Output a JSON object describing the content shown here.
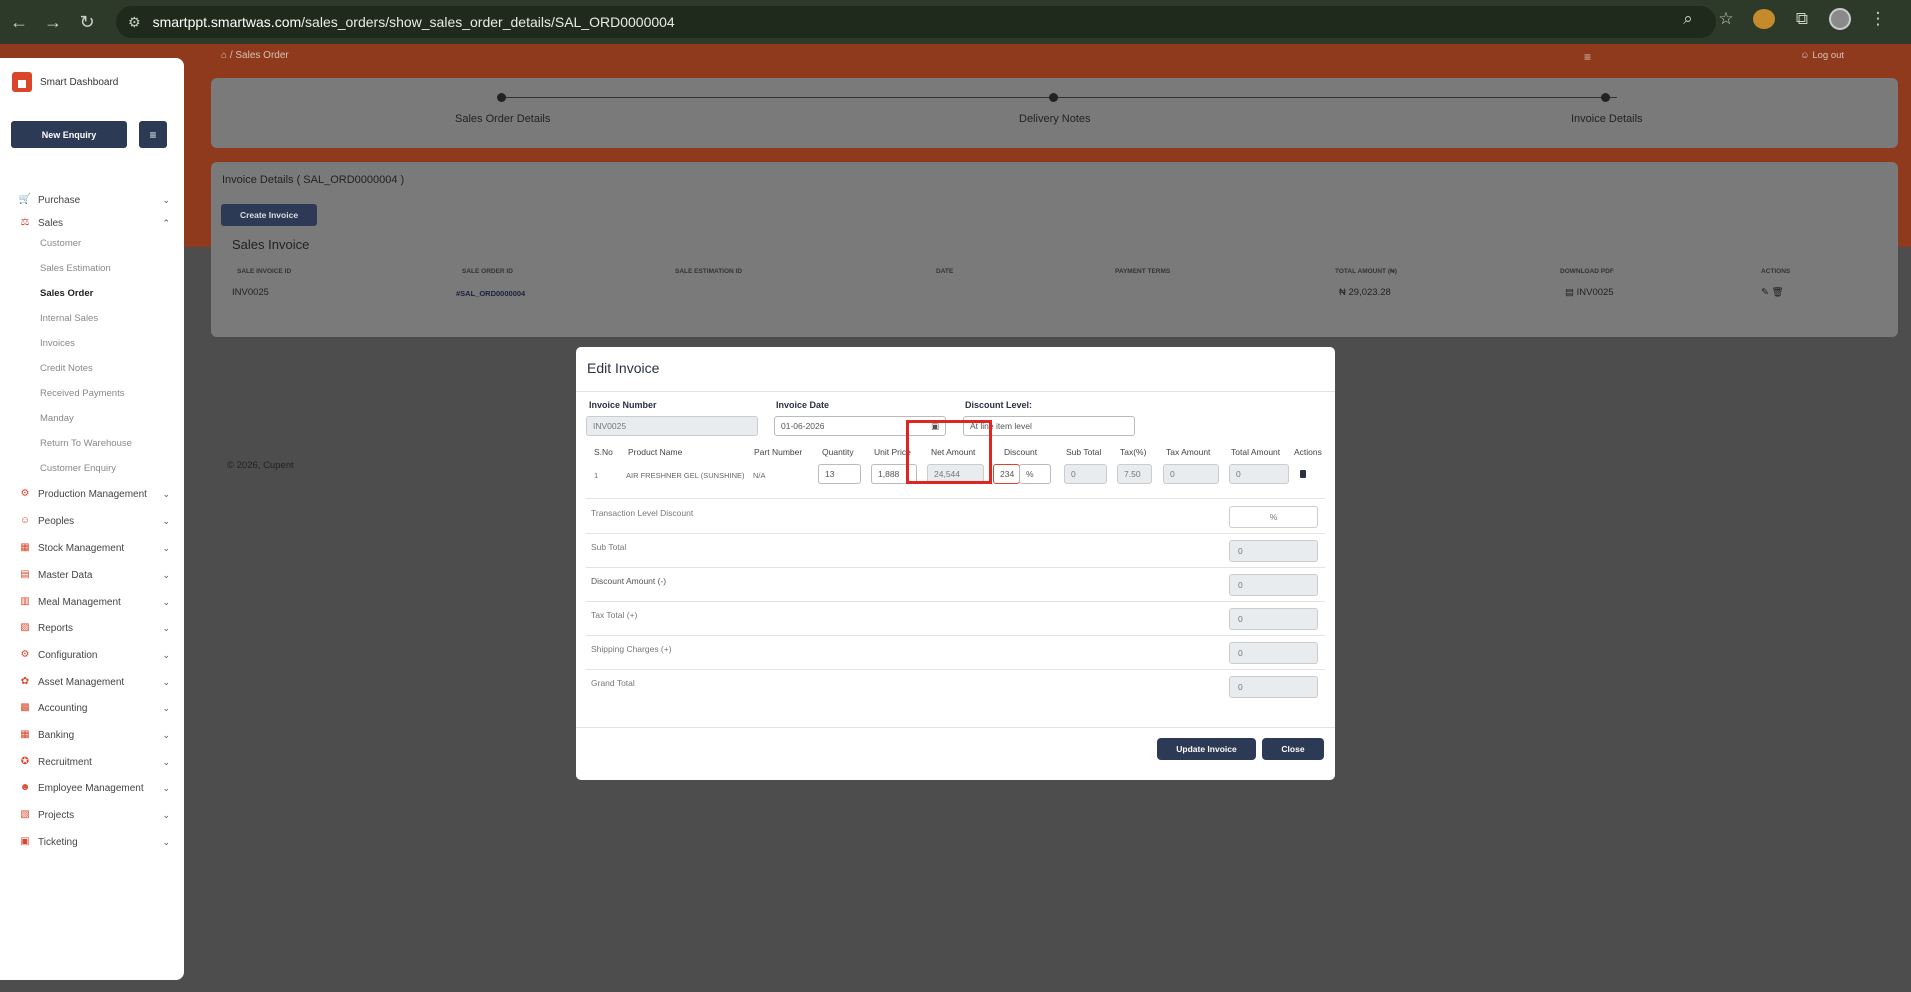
{
  "browser": {
    "url_host": "smartppt.smartwas.com",
    "url_path": "/sales_orders/show_sales_order_details/SAL_ORD0000004"
  },
  "sidebar": {
    "brand": "Smart Dashboard",
    "new_enquiry": "New Enquiry",
    "items": [
      {
        "label": "Purchase",
        "icon": "cart-icon"
      },
      {
        "label": "Sales",
        "icon": "sales-icon"
      },
      {
        "label": "Production Management",
        "icon": "factory-icon"
      },
      {
        "label": "Peoples",
        "icon": "people-icon"
      },
      {
        "label": "Stock Management",
        "icon": "stock-icon"
      },
      {
        "label": "Master Data",
        "icon": "data-icon"
      },
      {
        "label": "Meal Management",
        "icon": "meal-icon"
      },
      {
        "label": "Reports",
        "icon": "report-icon"
      },
      {
        "label": "Configuration",
        "icon": "config-icon"
      },
      {
        "label": "Asset Management",
        "icon": "asset-icon"
      },
      {
        "label": "Accounting",
        "icon": "accounting-icon"
      },
      {
        "label": "Banking",
        "icon": "bank-icon"
      },
      {
        "label": "Recruitment",
        "icon": "recruit-icon"
      },
      {
        "label": "Employee Management",
        "icon": "employee-icon"
      },
      {
        "label": "Projects",
        "icon": "project-icon"
      },
      {
        "label": "Ticketing",
        "icon": "ticket-icon"
      }
    ],
    "sales_sub": [
      "Customer",
      "Sales Estimation",
      "Sales Order",
      "Internal Sales",
      "Invoices",
      "Credit Notes",
      "Received Payments",
      "Manday",
      "Return To Warehouse",
      "Customer Enquiry"
    ]
  },
  "header": {
    "breadcrumb": "Sales Order",
    "logout": "Log out"
  },
  "steps": [
    "Sales Order Details",
    "Delivery Notes",
    "Invoice Details"
  ],
  "invoice_card": {
    "title": "Invoice Details ( SAL_ORD0000004 )",
    "create_button": "Create Invoice",
    "section": "Sales Invoice",
    "columns": [
      "SALE INVOICE ID",
      "SALE ORDER ID",
      "SALE ESTIMATION ID",
      "DATE",
      "PAYMENT TERMS",
      "TOTAL AMOUNT (₦)",
      "DOWNLOAD PDF",
      "ACTIONS"
    ],
    "row": {
      "invoice_id": "INV0025",
      "order_id": "#SAL_ORD0000004",
      "total": "₦ 29,023.28",
      "pdf": "INV0025"
    }
  },
  "footer": {
    "prefix": "© 2026,",
    "brand": "Cupent"
  },
  "modal": {
    "title": "Edit Invoice",
    "invoice_number_label": "Invoice Number",
    "invoice_number": "INV0025",
    "invoice_date_label": "Invoice Date",
    "invoice_date": "01-06-2026",
    "discount_level_label": "Discount Level:",
    "discount_level": "At line item level",
    "columns": [
      "S.No",
      "Product Name",
      "Part Number",
      "Quantity",
      "Unit Price",
      "Net Amount",
      "Discount",
      "Sub Total",
      "Tax(%)",
      "Tax Amount",
      "Total Amount",
      "Actions"
    ],
    "item": {
      "sno": "1",
      "product": "AIR FRESHNER GEL (SUNSHINE)",
      "part": "N/A",
      "quantity": "13",
      "unit_price": "1,888",
      "net_amount": "24,544",
      "discount": "234",
      "discount_type": "%",
      "sub_total": "0",
      "tax": "7.50",
      "tax_amount": "0",
      "total_amount": "0"
    },
    "summary": [
      {
        "label": "Transaction Level Discount",
        "value": "%"
      },
      {
        "label": "Sub Total",
        "value": "0"
      },
      {
        "label": "Discount Amount (-)",
        "value": "0"
      },
      {
        "label": "Tax Total (+)",
        "value": "0"
      },
      {
        "label": "Shipping Charges (+)",
        "value": "0"
      },
      {
        "label": "Grand Total",
        "value": "0"
      }
    ],
    "update_button": "Update Invoice",
    "close_button": "Close"
  }
}
